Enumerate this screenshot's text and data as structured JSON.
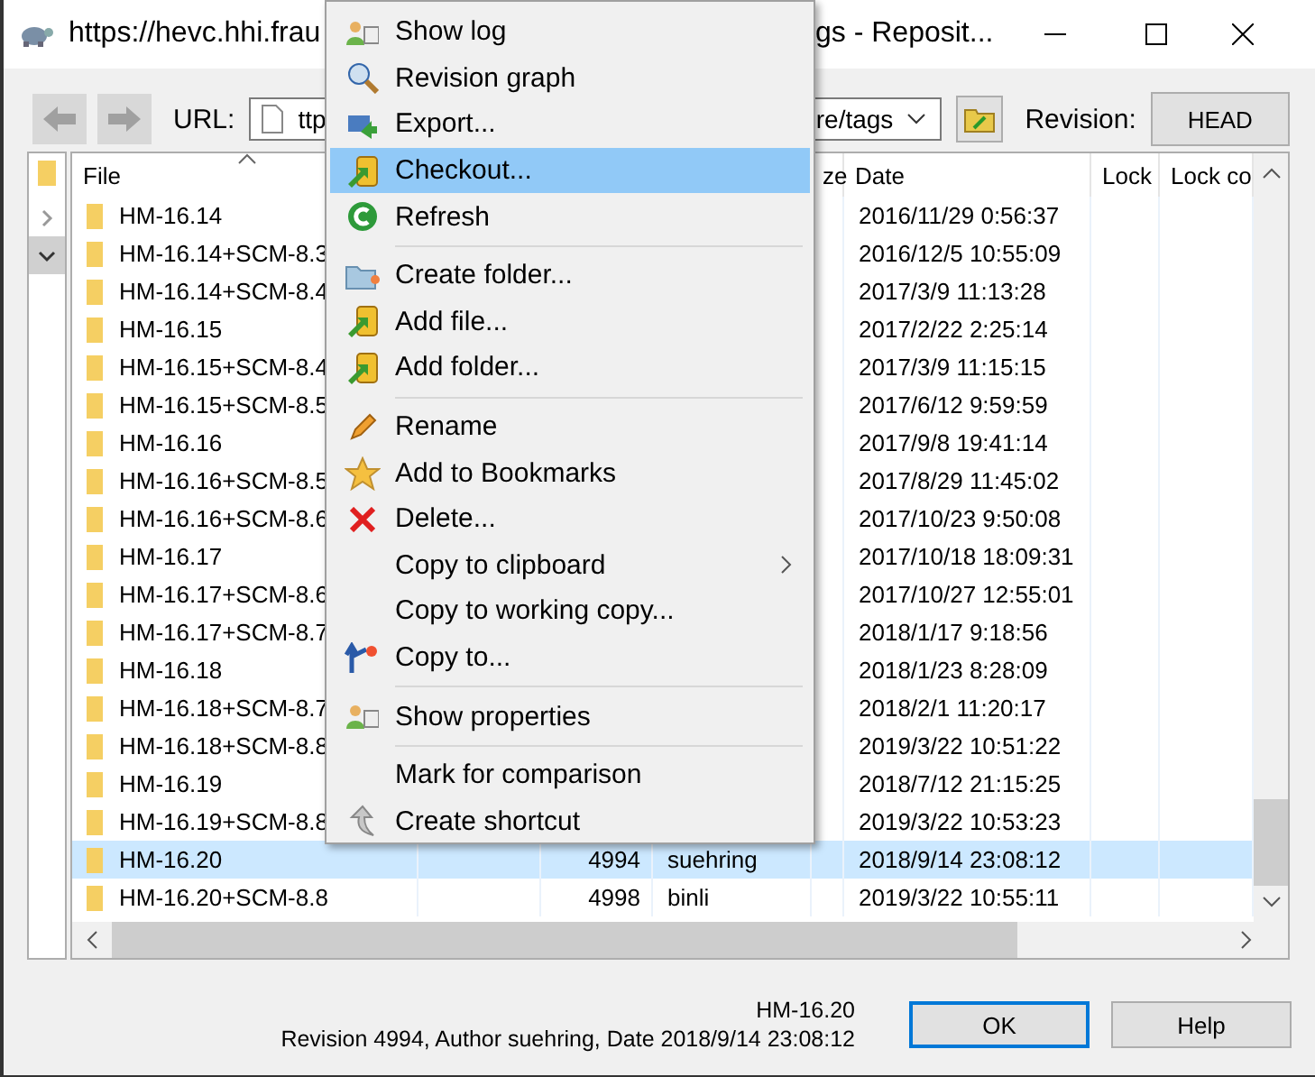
{
  "window": {
    "title_start": "https://hevc.hhi.frau",
    "title_end": "gs - Reposit..."
  },
  "toolbar": {
    "url_label": "URL:",
    "url_start": "ttp",
    "url_end": "re/tags",
    "revision_label": "Revision:",
    "revision_button": "HEAD"
  },
  "tree": [
    {
      "expanded": false,
      "selected": false
    },
    {
      "expanded": true,
      "selected": true
    }
  ],
  "columns": [
    {
      "label": "File"
    },
    {},
    {},
    {},
    {
      "label": "ze"
    },
    {
      "label": "Date"
    },
    {
      "label": "Lock"
    },
    {
      "label": "Lock co"
    }
  ],
  "rows": [
    {
      "name": "HM-16.14",
      "date": "2016/11/29 0:56:37",
      "selected": false
    },
    {
      "name": "HM-16.14+SCM-8.3",
      "date": "2016/12/5 10:55:09",
      "selected": false
    },
    {
      "name": "HM-16.14+SCM-8.4",
      "date": "2017/3/9 11:13:28",
      "selected": false
    },
    {
      "name": "HM-16.15",
      "date": "2017/2/22 2:25:14",
      "selected": false
    },
    {
      "name": "HM-16.15+SCM-8.4",
      "date": "2017/3/9 11:15:15",
      "selected": false
    },
    {
      "name": "HM-16.15+SCM-8.5",
      "date": "2017/6/12 9:59:59",
      "selected": false
    },
    {
      "name": "HM-16.16",
      "date": "2017/9/8 19:41:14",
      "selected": false
    },
    {
      "name": "HM-16.16+SCM-8.5",
      "date": "2017/8/29 11:45:02",
      "selected": false
    },
    {
      "name": "HM-16.16+SCM-8.6",
      "date": "2017/10/23 9:50:08",
      "selected": false
    },
    {
      "name": "HM-16.17",
      "date": "2017/10/18 18:09:31",
      "selected": false
    },
    {
      "name": "HM-16.17+SCM-8.6",
      "date": "2017/10/27 12:55:01",
      "selected": false
    },
    {
      "name": "HM-16.17+SCM-8.7",
      "date": "2018/1/17 9:18:56",
      "selected": false
    },
    {
      "name": "HM-16.18",
      "date": "2018/1/23 8:28:09",
      "selected": false
    },
    {
      "name": "HM-16.18+SCM-8.7",
      "date": "2018/2/1 11:20:17",
      "selected": false
    },
    {
      "name": "HM-16.18+SCM-8.8",
      "date": "2019/3/22 10:51:22",
      "selected": false
    },
    {
      "name": "HM-16.19",
      "date": "2018/7/12 21:15:25",
      "selected": false
    },
    {
      "name": "HM-16.19+SCM-8.8",
      "date": "2019/3/22 10:53:23",
      "selected": false
    },
    {
      "name": "HM-16.20",
      "revision": "4994",
      "author": "suehring",
      "date": "2018/9/14 23:08:12",
      "selected": true
    },
    {
      "name": "HM-16.20+SCM-8.8",
      "revision": "4998",
      "author": "binli",
      "date": "2019/3/22 10:55:11",
      "selected": false
    }
  ],
  "context_menu": [
    {
      "kind": "item",
      "label": "Show log",
      "selected": false
    },
    {
      "kind": "item",
      "label": "Revision graph",
      "selected": false
    },
    {
      "kind": "item",
      "label": "Export...",
      "selected": false
    },
    {
      "kind": "item",
      "label": "Checkout...",
      "selected": true
    },
    {
      "kind": "item",
      "label": "Refresh",
      "selected": false
    },
    {
      "kind": "separator"
    },
    {
      "kind": "item",
      "label": "Create folder...",
      "selected": false
    },
    {
      "kind": "item",
      "label": "Add file...",
      "selected": false
    },
    {
      "kind": "item",
      "label": "Add folder...",
      "selected": false
    },
    {
      "kind": "separator"
    },
    {
      "kind": "item",
      "label": "Rename",
      "selected": false
    },
    {
      "kind": "item",
      "label": "Add to Bookmarks",
      "selected": false
    },
    {
      "kind": "item",
      "label": "Delete...",
      "selected": false
    },
    {
      "kind": "item",
      "label": "Copy to clipboard",
      "selected": false,
      "submenu": true
    },
    {
      "kind": "item",
      "label": "Copy to working copy...",
      "selected": false
    },
    {
      "kind": "item",
      "label": "Copy to...",
      "selected": false
    },
    {
      "kind": "separator"
    },
    {
      "kind": "item",
      "label": "Show properties",
      "selected": false
    },
    {
      "kind": "separator"
    },
    {
      "kind": "item",
      "label": "Mark for comparison",
      "selected": false
    },
    {
      "kind": "item",
      "label": "Create shortcut",
      "selected": false
    }
  ],
  "status": {
    "name": "HM-16.20",
    "info": "Revision 4994, Author suehring, Date 2018/9/14 23:08:12"
  },
  "buttons": [
    {
      "label": "OK",
      "default": true
    },
    {
      "label": "Help",
      "default": false
    }
  ]
}
